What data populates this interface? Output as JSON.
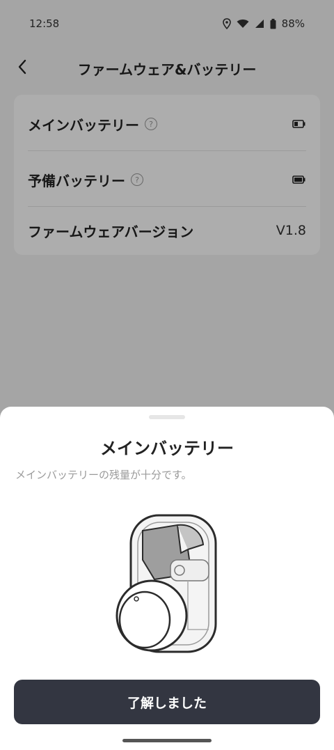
{
  "status": {
    "time": "12:58",
    "battery": "88%"
  },
  "header": {
    "title": "ファームウェア&バッテリー"
  },
  "settings": {
    "main_battery_label": "メインバッテリー",
    "backup_battery_label": "予備バッテリー",
    "firmware_label": "ファームウェアバージョン",
    "firmware_value": "V1.8"
  },
  "sheet": {
    "title": "メインバッテリー",
    "description": "メインバッテリーの残量が十分です。",
    "ok_button": "了解しました"
  }
}
